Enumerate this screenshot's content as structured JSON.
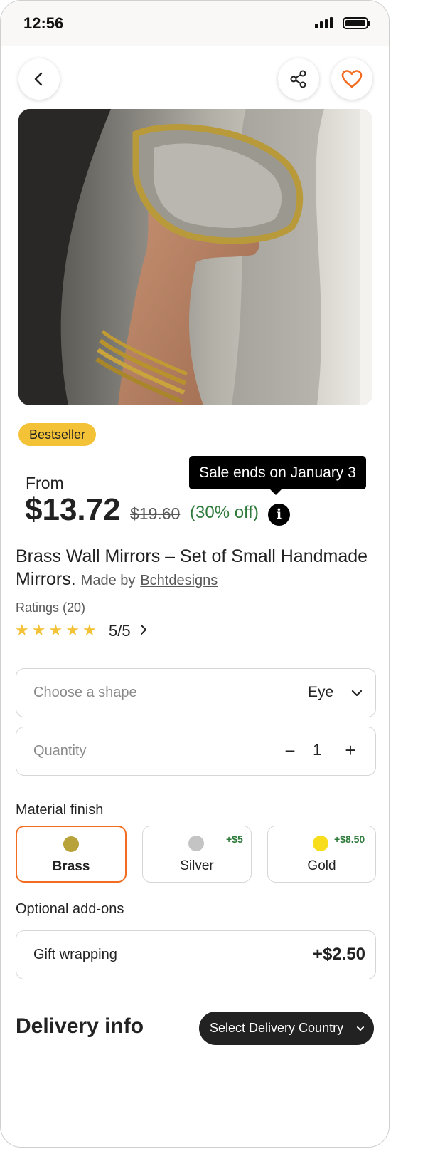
{
  "status_bar": {
    "time": "12:56"
  },
  "colors": {
    "accent": "#f26d21",
    "badge": "#f3c236",
    "discount_green": "#2d7a3a",
    "dark": "#222222"
  },
  "icons": {
    "back": "chevron-left-icon",
    "share": "share-icon",
    "favorite": "heart-icon",
    "info": "info-icon",
    "dropdown": "chevron-down-icon",
    "rating_more": "chevron-right-icon"
  },
  "product": {
    "badge": "Bestseller",
    "from_label": "From",
    "price": "$13.72",
    "original_price": "$19.60",
    "discount": "(30% off)",
    "tooltip": "Sale ends on January 3",
    "title": "Brass Wall Mirrors – Set of Small Handmade Mirrors.",
    "maker_prefix": "Made by",
    "maker": "Bchtdesigns",
    "ratings_label": "Ratings (20)",
    "rating_value": "5/5",
    "stars": 5
  },
  "shape": {
    "placeholder": "Choose a shape",
    "value": "Eye"
  },
  "quantity": {
    "placeholder": "Quantity",
    "value": "1",
    "minus": "−",
    "plus": "+"
  },
  "material": {
    "label": "Material finish",
    "options": [
      {
        "name": "Brass",
        "surcharge": "",
        "color": "#b8a23a",
        "selected": true
      },
      {
        "name": "Silver",
        "surcharge": "+$5",
        "color": "#c4c4c4",
        "selected": false
      },
      {
        "name": "Gold",
        "surcharge": "+$8.50",
        "color": "#f7dd1b",
        "selected": false
      }
    ]
  },
  "addons": {
    "label": "Optional add-ons",
    "items": [
      {
        "name": "Gift wrapping",
        "price": "+$2.50"
      }
    ]
  },
  "delivery": {
    "title": "Delivery info",
    "button": "Select Delivery Country"
  }
}
